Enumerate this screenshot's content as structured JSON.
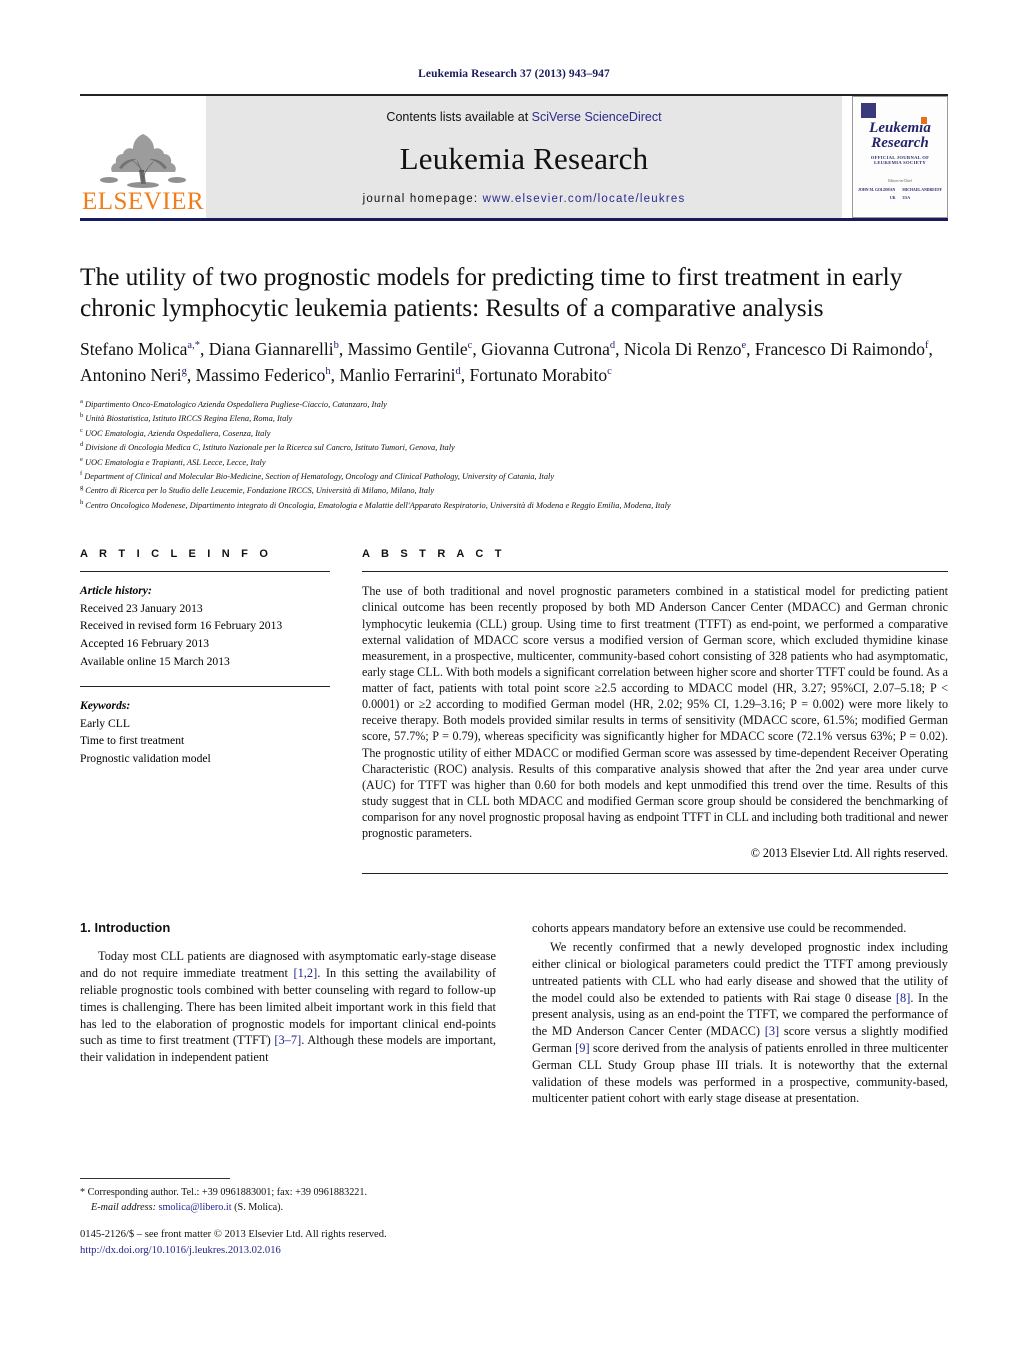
{
  "running_head": "Leukemia Research 37 (2013) 943–947",
  "masthead": {
    "publisher_wordmark": "ELSEVIER",
    "contents_prefix": "Contents lists available at",
    "contents_link": "SciVerse ScienceDirect",
    "journal_title": "Leukemia Research",
    "homepage_label": "journal homepage:",
    "homepage_url": "www.elsevier.com/locate/leukres",
    "cover": {
      "title_line1": "Leukemia",
      "title_line2": "Research",
      "subtitle": "OFFICIAL JOURNAL OF LEUKEMIA SOCIETY",
      "editor_label": "Editors-in-Chief",
      "editor_1": "JOHN M. GOLDMAN",
      "editor_1_loc": "UK",
      "editor_2": "MICHAEL ANDREEFF",
      "editor_2_loc": "USA"
    }
  },
  "article": {
    "title": "The utility of two prognostic models for predicting time to first treatment in early chronic lymphocytic leukemia patients: Results of a comparative analysis",
    "authors": [
      {
        "name": "Stefano Molica",
        "marks": "a,*"
      },
      {
        "name": "Diana Giannarelli",
        "marks": "b"
      },
      {
        "name": "Massimo Gentile",
        "marks": "c"
      },
      {
        "name": "Giovanna Cutrona",
        "marks": "d"
      },
      {
        "name": "Nicola Di Renzo",
        "marks": "e"
      },
      {
        "name": "Francesco Di Raimondo",
        "marks": "f"
      },
      {
        "name": "Antonino Neri",
        "marks": "g"
      },
      {
        "name": "Massimo Federico",
        "marks": "h"
      },
      {
        "name": "Manlio Ferrarini",
        "marks": "d"
      },
      {
        "name": "Fortunato Morabito",
        "marks": "c"
      }
    ],
    "affiliations": [
      {
        "mark": "a",
        "text": "Dipartimento Onco-Ematologico Azienda Ospedaliera Pugliese-Ciaccio, Catanzaro, Italy"
      },
      {
        "mark": "b",
        "text": "Unità Biostatistica, Istituto IRCCS Regina Elena, Roma, Italy"
      },
      {
        "mark": "c",
        "text": "UOC Ematologia, Azienda Ospedaliera, Cosenza, Italy"
      },
      {
        "mark": "d",
        "text": "Divisione di Oncologia Medica C, Istituto Nazionale per la Ricerca sul Cancro, Istituto Tumori, Genova, Italy"
      },
      {
        "mark": "e",
        "text": "UOC Ematologia e Trapianti, ASL Lecce, Lecce, Italy"
      },
      {
        "mark": "f",
        "text": "Department of Clinical and Molecular Bio-Medicine, Section of Hematology, Oncology and Clinical Pathology, University of Catania, Italy"
      },
      {
        "mark": "g",
        "text": "Centro di Ricerca per lo Studio delle Leucemie, Fondazione IRCCS, Università di Milano, Milano, Italy"
      },
      {
        "mark": "h",
        "text": "Centro Oncologico Modenese, Dipartimento integrato di Oncologia, Ematologia e Malattie dell'Apparato Respiratorio, Università di Modena e Reggio Emilia, Modena, Italy"
      }
    ]
  },
  "article_info": {
    "heading": "A R T I C L E   I N F O",
    "history_title": "Article history:",
    "history": [
      "Received 23 January 2013",
      "Received in revised form 16 February 2013",
      "Accepted 16 February 2013",
      "Available online 15 March 2013"
    ],
    "keywords_title": "Keywords:",
    "keywords": [
      "Early CLL",
      "Time to first treatment",
      "Prognostic validation model"
    ]
  },
  "abstract": {
    "heading": "A B S T R A C T",
    "text": "The use of both traditional and novel prognostic parameters combined in a statistical model for predicting patient clinical outcome has been recently proposed by both MD Anderson Cancer Center (MDACC) and German chronic lymphocytic leukemia (CLL) group. Using time to first treatment (TTFT) as end-point, we performed a comparative external validation of MDACC score versus a modified version of German score, which excluded thymidine kinase measurement, in a prospective, multicenter, community-based cohort consisting of 328 patients who had asymptomatic, early stage CLL. With both models a significant correlation between higher score and shorter TTFT could be found. As a matter of fact, patients with total point score ≥2.5 according to MDACC model (HR, 3.27; 95%CI, 2.07–5.18; P < 0.0001) or ≥2 according to modified German model (HR, 2.02; 95% CI, 1.29–3.16; P = 0.002) were more likely to receive therapy. Both models provided similar results in terms of sensitivity (MDACC score, 61.5%; modified German score, 57.7%; P = 0.79), whereas specificity was significantly higher for MDACC score (72.1% versus 63%; P = 0.02). The prognostic utility of either MDACC or modified German score was assessed by time-dependent Receiver Operating Characteristic (ROC) analysis. Results of this comparative analysis showed that after the 2nd year area under curve (AUC) for TTFT was higher than 0.60 for both models and kept unmodified this trend over the time. Results of this study suggest that in CLL both MDACC and modified German score group should be considered the benchmarking of comparison for any novel prognostic proposal having as endpoint TTFT in CLL and including both traditional and newer prognostic parameters.",
    "copyright": "© 2013 Elsevier Ltd. All rights reserved."
  },
  "body": {
    "section_number_title": "1.  Introduction",
    "left_para_1_a": "Today most CLL patients are diagnosed with asymptomatic early-stage disease and do not require immediate treatment ",
    "left_ref_1": "[1,2]",
    "left_para_1_b": ". In this setting the availability of reliable prognostic tools combined with better counseling with regard to follow-up times is challenging. There has been limited albeit important work in this field that has led to the elaboration of prognostic models for important clinical end-points such as time to first treatment (TTFT) ",
    "left_ref_2": "[3–7]",
    "left_para_1_c": ". Although these models are important, their validation in independent patient",
    "right_para_1": "cohorts appears mandatory before an extensive use could be recommended.",
    "right_para_2_a": "We recently confirmed that a newly developed prognostic index including either clinical or biological parameters could predict the TTFT among previously untreated patients with CLL who had early disease and showed that the utility of the model could also be extended to patients with Rai stage 0 disease ",
    "right_ref_1": "[8]",
    "right_para_2_b": ". In the present analysis, using as an end-point the TTFT, we compared the performance of the MD Anderson Cancer Center (MDACC) ",
    "right_ref_2": "[3]",
    "right_para_2_c": " score versus a slightly modified German ",
    "right_ref_3": "[9]",
    "right_para_2_d": " score derived from the analysis of patients enrolled in three multicenter German CLL Study Group phase III trials. It is noteworthy that the external validation of these models was performed in a prospective, community-based, multicenter patient cohort with early stage disease at presentation."
  },
  "footnote": {
    "star": "*",
    "corresponding": "Corresponding author. Tel.: +39 0961883001; fax: +39 0961883221.",
    "email_label": "E-mail address:",
    "email": "smolica@libero.it",
    "email_suffix": "(S. Molica)."
  },
  "footer": {
    "issn_line": "0145-2126/$ – see front matter © 2013 Elsevier Ltd. All rights reserved.",
    "doi": "http://dx.doi.org/10.1016/j.leukres.2013.02.016"
  },
  "colors": {
    "link_blue": "#1f1f8c",
    "header_blue": "#1a1a5e",
    "elsevier_orange": "#F07D1A",
    "masthead_grey": "#e6e6e6"
  }
}
